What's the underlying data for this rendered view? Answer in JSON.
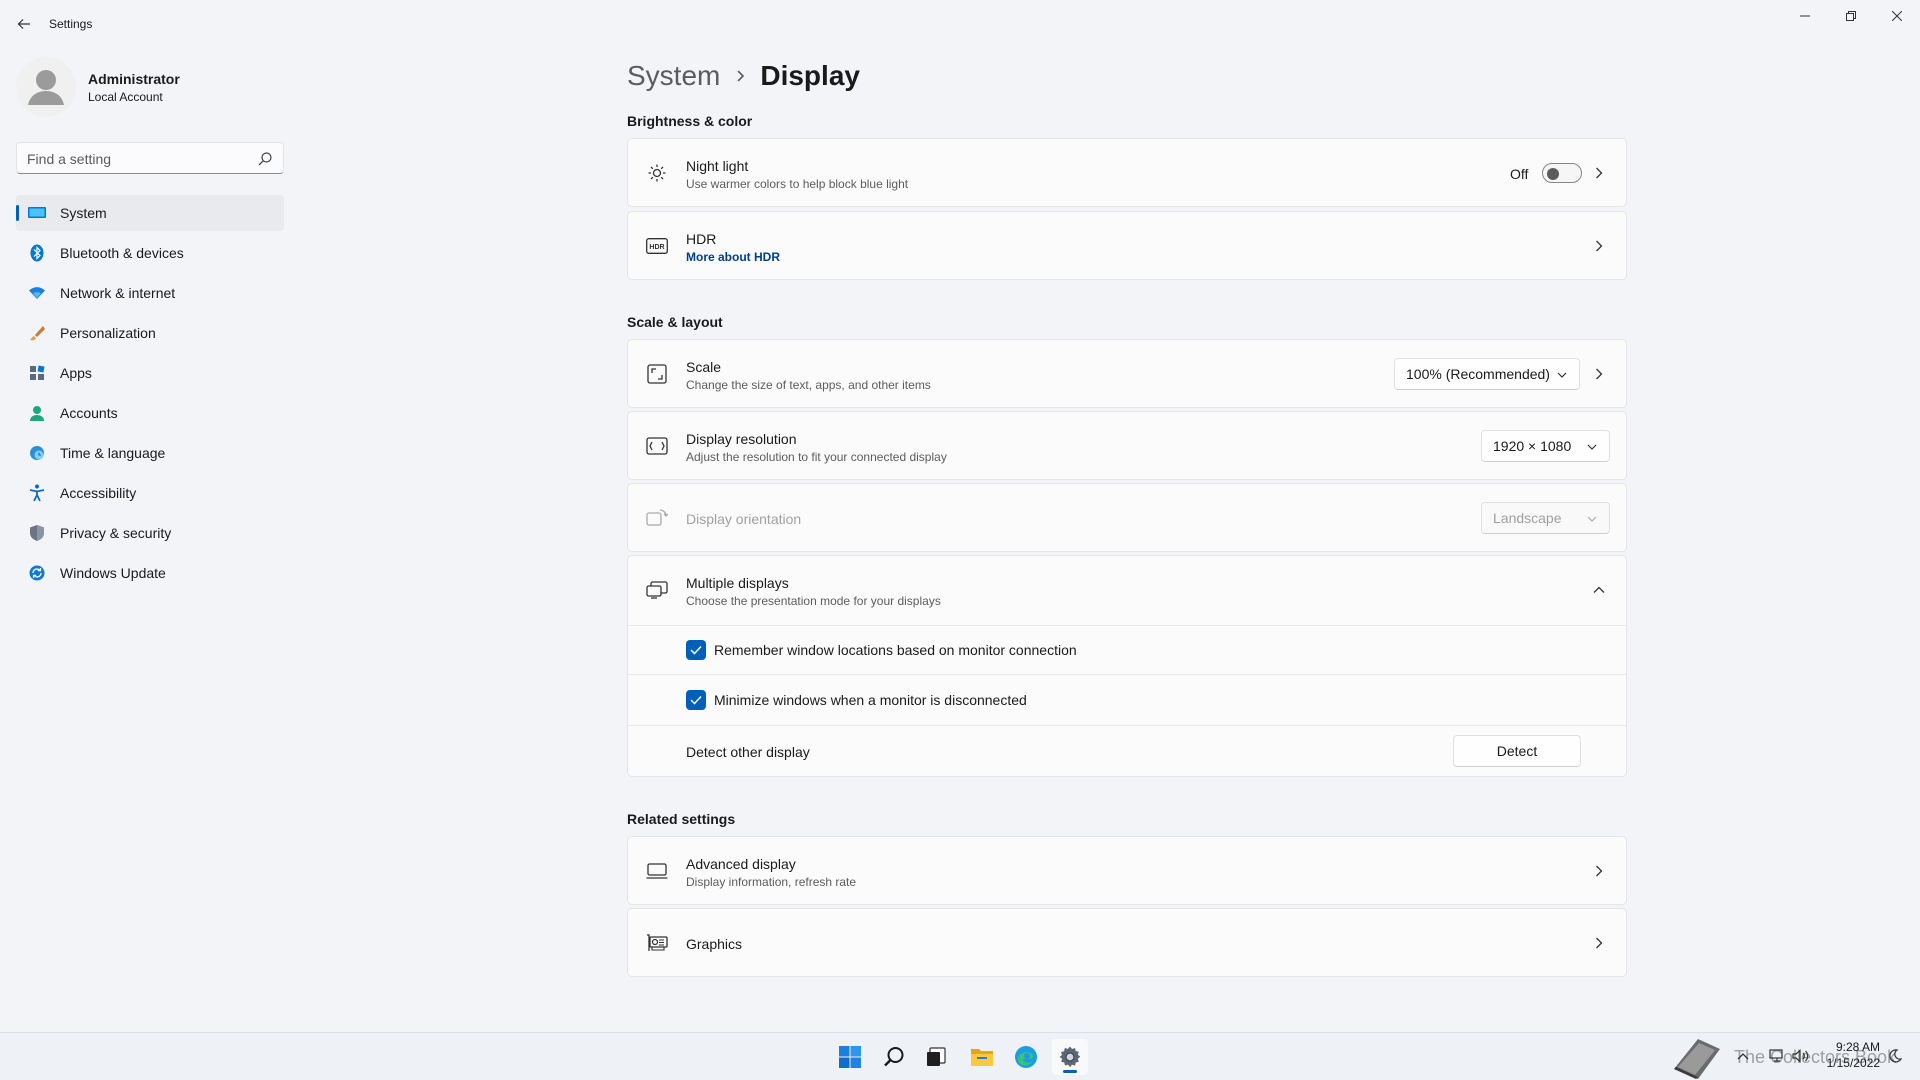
{
  "window": {
    "title": "Settings"
  },
  "profile": {
    "name": "Administrator",
    "account_type": "Local Account"
  },
  "search": {
    "placeholder": "Find a setting"
  },
  "sidebar": {
    "items": [
      {
        "label": "System",
        "icon": "monitor-icon",
        "active": true
      },
      {
        "label": "Bluetooth & devices",
        "icon": "bluetooth-icon"
      },
      {
        "label": "Network & internet",
        "icon": "wifi-icon"
      },
      {
        "label": "Personalization",
        "icon": "brush-icon"
      },
      {
        "label": "Apps",
        "icon": "apps-icon"
      },
      {
        "label": "Accounts",
        "icon": "person-icon"
      },
      {
        "label": "Time & language",
        "icon": "globe-clock-icon"
      },
      {
        "label": "Accessibility",
        "icon": "accessibility-icon"
      },
      {
        "label": "Privacy & security",
        "icon": "shield-icon"
      },
      {
        "label": "Windows Update",
        "icon": "update-icon"
      }
    ]
  },
  "breadcrumb": {
    "parent": "System",
    "current": "Display"
  },
  "sections": {
    "brightness": "Brightness & color",
    "scale_layout": "Scale & layout",
    "related": "Related settings"
  },
  "night_light": {
    "title": "Night light",
    "subtitle": "Use warmer colors to help block blue light",
    "state": "Off"
  },
  "hdr": {
    "title": "HDR",
    "link": "More about HDR"
  },
  "scale": {
    "title": "Scale",
    "subtitle": "Change the size of text, apps, and other items",
    "value": "100% (Recommended)"
  },
  "resolution": {
    "title": "Display resolution",
    "subtitle": "Adjust the resolution to fit your connected display",
    "value": "1920 × 1080"
  },
  "orientation": {
    "title": "Display orientation",
    "value": "Landscape",
    "disabled": true
  },
  "multiple_displays": {
    "title": "Multiple displays",
    "subtitle": "Choose the presentation mode for your displays",
    "remember_label": "Remember window locations based on monitor connection",
    "remember_checked": true,
    "minimize_label": "Minimize windows when a monitor is disconnected",
    "minimize_checked": true,
    "detect_label": "Detect other display",
    "detect_button": "Detect"
  },
  "advanced_display": {
    "title": "Advanced display",
    "subtitle": "Display information, refresh rate"
  },
  "graphics": {
    "title": "Graphics"
  },
  "taskbar": {
    "time": "9:28 AM",
    "date": "1/15/2022",
    "watermark": "The Collectors Book"
  },
  "colors": {
    "accent": "#005fb8",
    "link": "#003e92",
    "background": "#f3f4f8",
    "card": "#fbfbfc"
  }
}
